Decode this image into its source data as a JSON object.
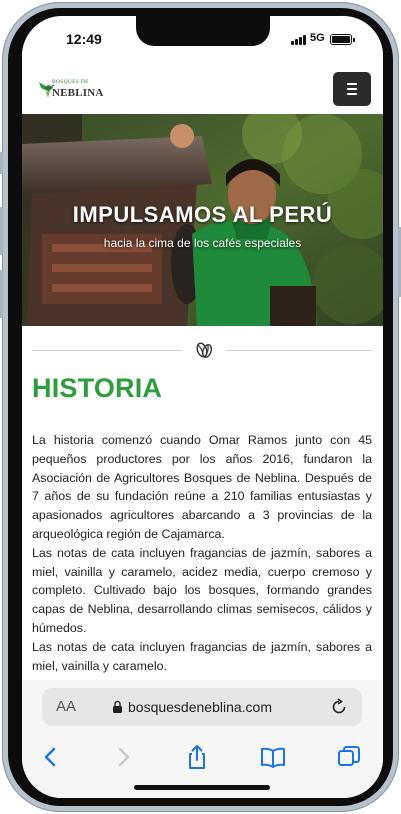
{
  "status_bar": {
    "time": "12:49",
    "network": "5G"
  },
  "site": {
    "logo_top": "BOSQUES DE",
    "logo_bottom": "NEBLINA",
    "menu_icon": "hamburger-icon"
  },
  "hero": {
    "title": "IMPULSAMOS AL PERÚ",
    "subtitle": "hacia la cima de los cafés especiales"
  },
  "historia": {
    "title": "HISTORIA",
    "paragraph": "La historia comenzó cuando Omar Ramos junto con 45 pequeños productores por los años 2016, fundaron la Asociación de Agricultores Bosques de Neblina. Después de 7 años de su fundación reúne a 210 familias entusiastas y apasionados agricultores abarcando a 3 provincias de la arqueológica región de Cajamarca.\nLas notas de cata incluyen fragancias de jazmín, sabores a miel, vainilla y caramelo, acidez media, cuerpo cremoso y completo. Cultivado bajo los bosques, formando grandes capas de Neblina, desarrollando climas semisecos, cálidos y húmedos.\nLas notas de cata incluyen fragancias de jazmín, sabores a miel, vainilla y caramelo."
  },
  "browser": {
    "aa_label": "AA",
    "url": "bosquesdeneblina.com"
  },
  "colors": {
    "accent_green": "#2e9d3e",
    "ios_blue": "#1a73e8"
  }
}
